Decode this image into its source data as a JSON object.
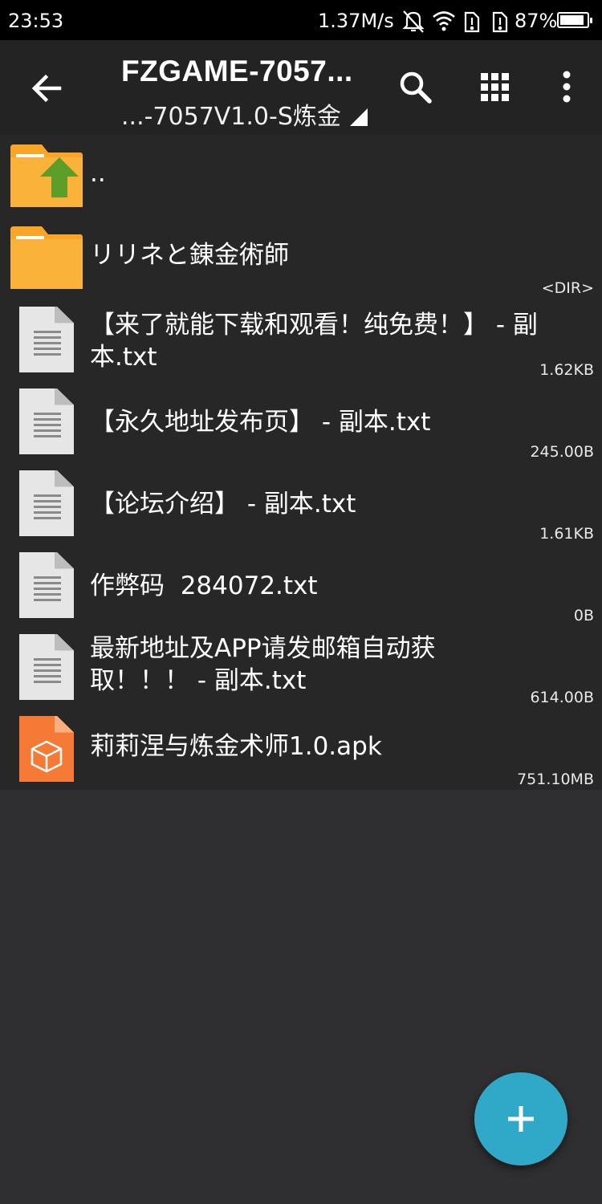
{
  "status_bar": {
    "time": "23:53",
    "net_speed": "1.37M/s",
    "battery": "87%",
    "icons": [
      "bell-off-icon",
      "wifi-icon",
      "sim1-icon",
      "sim2-icon",
      "battery-icon"
    ]
  },
  "toolbar": {
    "title": "FZGAME-7057...",
    "subtitle": "...-7057V1.0-S炼金",
    "icons": [
      "back-arrow-icon",
      "search-icon",
      "grid-view-icon",
      "more-vert-icon"
    ]
  },
  "files": [
    {
      "name": "..",
      "meta": "",
      "type": "parent-folder"
    },
    {
      "name": "リリネと錬金術師",
      "meta": "<DIR>",
      "type": "folder"
    },
    {
      "name": "【来了就能下载和观看！纯免费！】 - 副本.txt",
      "meta": "1.62KB",
      "type": "text"
    },
    {
      "name": "【永久地址发布页】 - 副本.txt",
      "meta": "245.00B",
      "type": "text"
    },
    {
      "name": "【论坛介绍】 - 副本.txt",
      "meta": "1.61KB",
      "type": "text"
    },
    {
      "name": "作弊码  284072.txt",
      "meta": "0B",
      "type": "text"
    },
    {
      "name": "最新地址及APP请发邮箱自动获取！！！ - 副本.txt",
      "meta": "614.00B",
      "type": "text"
    },
    {
      "name": "莉莉涅与炼金术师1.0.apk",
      "meta": "751.10MB",
      "type": "apk"
    }
  ],
  "colors": {
    "toolbar": "#232323",
    "list_bg": "#272727",
    "page_bg": "#2f2f31",
    "folder": "#f9a526",
    "apk": "#f57a35",
    "fab": "#2fa9c7"
  },
  "fab": {
    "icon": "add-icon"
  }
}
